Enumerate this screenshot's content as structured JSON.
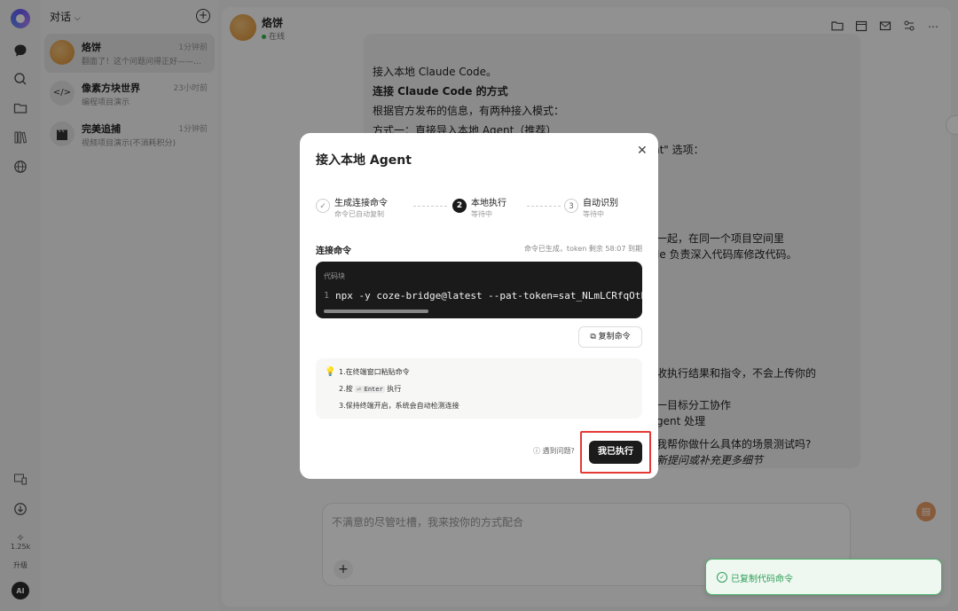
{
  "sidebar": {
    "stat_value": "1.25k",
    "stat_label": "升级",
    "ai_badge": "AI"
  },
  "conversations": {
    "header": "对话",
    "items": [
      {
        "name": "烙饼",
        "time": "1分钟前",
        "preview": "翻面了！这个问题问得正好——扣..."
      },
      {
        "name": "像素方块世界",
        "time": "23小时前",
        "preview": "编程项目演示"
      },
      {
        "name": "完美追捕",
        "time": "1分钟前",
        "preview": "视频项目演示(不消耗积分)"
      }
    ]
  },
  "chat": {
    "title": "烙饼",
    "status": "在线",
    "input_placeholder": "不满意的尽管吐槽，我来按你的方式配合",
    "message_lines": [
      {
        "text": "接入本地 Claude Code。",
        "style": ""
      },
      {
        "text": "连接 Claude Code 的方式",
        "style": "b"
      },
      {
        "text": "根据官方发布的信息，有两种接入模式：",
        "style": ""
      },
      {
        "text": "方式一：直接导入本地 Agent（推荐）",
        "style": ""
      }
    ],
    "peek_lines": [
      "nt\" 选项：",
      "一起，在同一个项目空间里",
      "le 负责深入代码库修改代码。",
      "收执行结果和指令，不会上传你的",
      "一目标分工协作",
      "gent 处理",
      "我帮你做什么具体的场景测试吗?",
      "新提问或补充更多细节"
    ]
  },
  "modal": {
    "title": "接入本地 Agent",
    "steps": [
      {
        "number": "✓",
        "label": "生成连接命令",
        "status": "命令已自动复制"
      },
      {
        "number": "2",
        "label": "本地执行",
        "status": "等待中"
      },
      {
        "number": "3",
        "label": "自动识别",
        "status": "等待中"
      }
    ],
    "command_label": "连接命令",
    "command_meta": "命令已生成，token 剩余 58:07 到期",
    "code_header": "代码块",
    "line_number": "1",
    "command": "npx -y coze-bridge@latest --pat-token=sat_NLmLCRfqOtPS",
    "copy_button": "复制命令",
    "tips": {
      "t1": "1.在终端窗口粘贴命令",
      "t2_pre": "2.按",
      "t2_key": "⏎ Enter",
      "t2_post": "执行",
      "t3": "3.保持终端开启，系统会自动检测连接"
    },
    "help": "遇到问题?",
    "confirm_button": "我已执行"
  },
  "toast": {
    "text": "已复制代码命令"
  }
}
